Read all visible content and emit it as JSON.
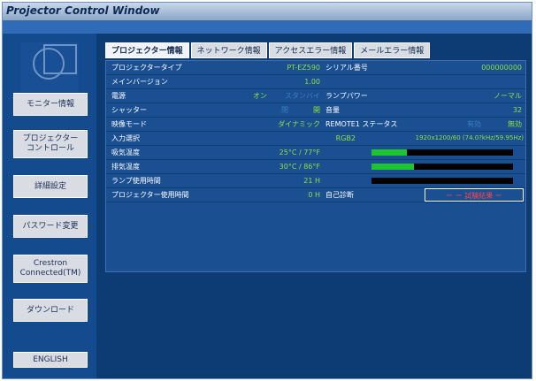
{
  "window": {
    "title": "Projector Control Window"
  },
  "sidebar": {
    "items": [
      {
        "label": "モニター情報"
      },
      {
        "label": "プロジェクター\nコントロール"
      },
      {
        "label": "詳細設定"
      },
      {
        "label": "パスワード変更"
      },
      {
        "label": "Crestron\nConnected(TM)"
      },
      {
        "label": "ダウンロード"
      }
    ],
    "language_button": "ENGLISH"
  },
  "tabs": [
    {
      "label": "プロジェクター情報",
      "active": true
    },
    {
      "label": "ネットワーク情報",
      "active": false
    },
    {
      "label": "アクセスエラー情報",
      "active": false
    },
    {
      "label": "メールエラー情報",
      "active": false
    }
  ],
  "info": {
    "projector_type_label": "プロジェクタータイプ",
    "projector_type_value": "PT-EZ590",
    "serial_label": "シリアル番号",
    "serial_value": "000000000",
    "main_version_label": "メインバージョン",
    "main_version_value": "1.00",
    "power_label": "電源",
    "power_on": "オン",
    "power_standby": "スタンバイ",
    "lamp_power_label": "ランプパワー",
    "lamp_power_value": "ノーマル",
    "shutter_label": "シャッター",
    "shutter_closed": "閉",
    "shutter_open": "開",
    "volume_label": "音量",
    "volume_value": "32",
    "picture_mode_label": "映像モード",
    "picture_mode_value": "ダイナミック",
    "remote_label": "REMOTE1 ステータス",
    "remote_valid": "有効",
    "remote_invalid": "無効",
    "input_label": "入力選択",
    "input_value": "RGB2",
    "signal_value": "1920x1200/60 (74.0?kHz/59.95Hz)",
    "intake_temp_label": "吸気温度",
    "intake_temp_value": "25°C / 77°F",
    "intake_temp_level": 0.25,
    "exhaust_temp_label": "排気温度",
    "exhaust_temp_value": "30°C / 86°F",
    "exhaust_temp_level": 0.3,
    "lamp_hours_label": "ランプ使用時間",
    "lamp_hours_value": "21 H",
    "lamp_hours_level": 0.0,
    "projector_hours_label": "プロジェクター使用時間",
    "projector_hours_value": "0 H",
    "self_diag_label": "自己診断",
    "self_diag_value": "ー ー 試験結果 ー"
  },
  "colors": {
    "value_green": "#8fe03b",
    "bar_green": "#1fc52e",
    "alert_red": "#ff4747",
    "panel_blue": "#1a4f92"
  }
}
